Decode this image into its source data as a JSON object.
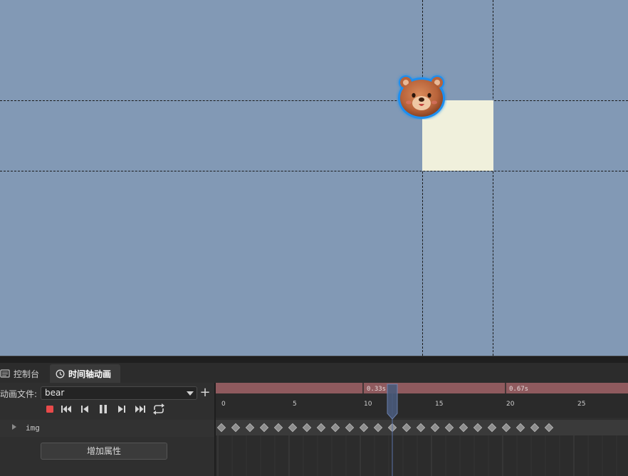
{
  "tabs": [
    {
      "label": "控制台",
      "icon": "console-icon",
      "active": false
    },
    {
      "label": "时间轴动画",
      "icon": "clock-icon",
      "active": true
    }
  ],
  "animation": {
    "file_label": "动画文件:",
    "file_value": "bear",
    "add_label": "+"
  },
  "controls": [
    "record-button",
    "first-frame-button",
    "prev-frame-button",
    "pause-button",
    "next-frame-button",
    "last-frame-button",
    "loop-button"
  ],
  "track": {
    "name": "img",
    "add_property_label": "增加属性"
  },
  "timeline": {
    "time_markers": [
      "0.33s",
      "0.67s"
    ],
    "frame_ticks": [
      "0",
      "5",
      "10",
      "15",
      "20",
      "25"
    ],
    "current_frame": 12,
    "keyframes": [
      0,
      1,
      2,
      3,
      4,
      5,
      6,
      7,
      8,
      9,
      10,
      11,
      12,
      13,
      14,
      15,
      16,
      17,
      18,
      19,
      20,
      21,
      22,
      23
    ],
    "marker_color": "#8f5a5e",
    "playhead_color": "#4a5a7a"
  },
  "scene": {
    "background": "#8299b5",
    "node_color": "#f0f0dc",
    "sprite": "bear-sprite"
  }
}
